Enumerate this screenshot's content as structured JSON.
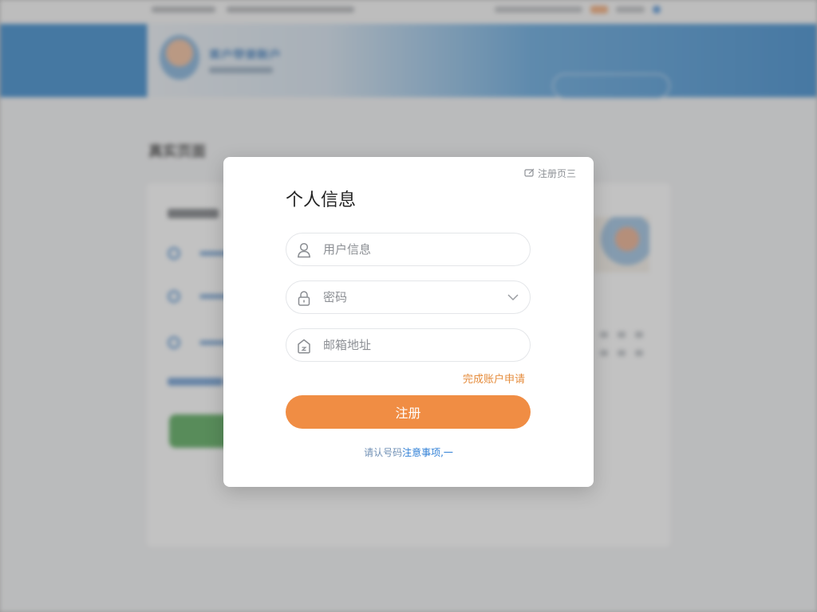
{
  "modal": {
    "corner_link": "注册页三",
    "title": "个人信息",
    "fields": {
      "username": {
        "placeholder": "用户信息",
        "icon": "user-icon"
      },
      "password": {
        "placeholder": "密码",
        "icon": "lock-icon",
        "dropdown_icon": "chevron-down-icon"
      },
      "email": {
        "placeholder": "邮箱地址",
        "icon": "mail-icon"
      }
    },
    "finish_link": "完成账户申请",
    "submit_label": "注册",
    "notice_prefix": "请认号码",
    "notice_link": "注意事项,一"
  },
  "background": {
    "banner_title": "客户登录账户",
    "section_title": "真实页面"
  },
  "colors": {
    "accent": "#f08d44",
    "link_orange": "#e58c3c",
    "link_blue": "#2f7fd6",
    "banner_blue": "#1c78c5"
  }
}
